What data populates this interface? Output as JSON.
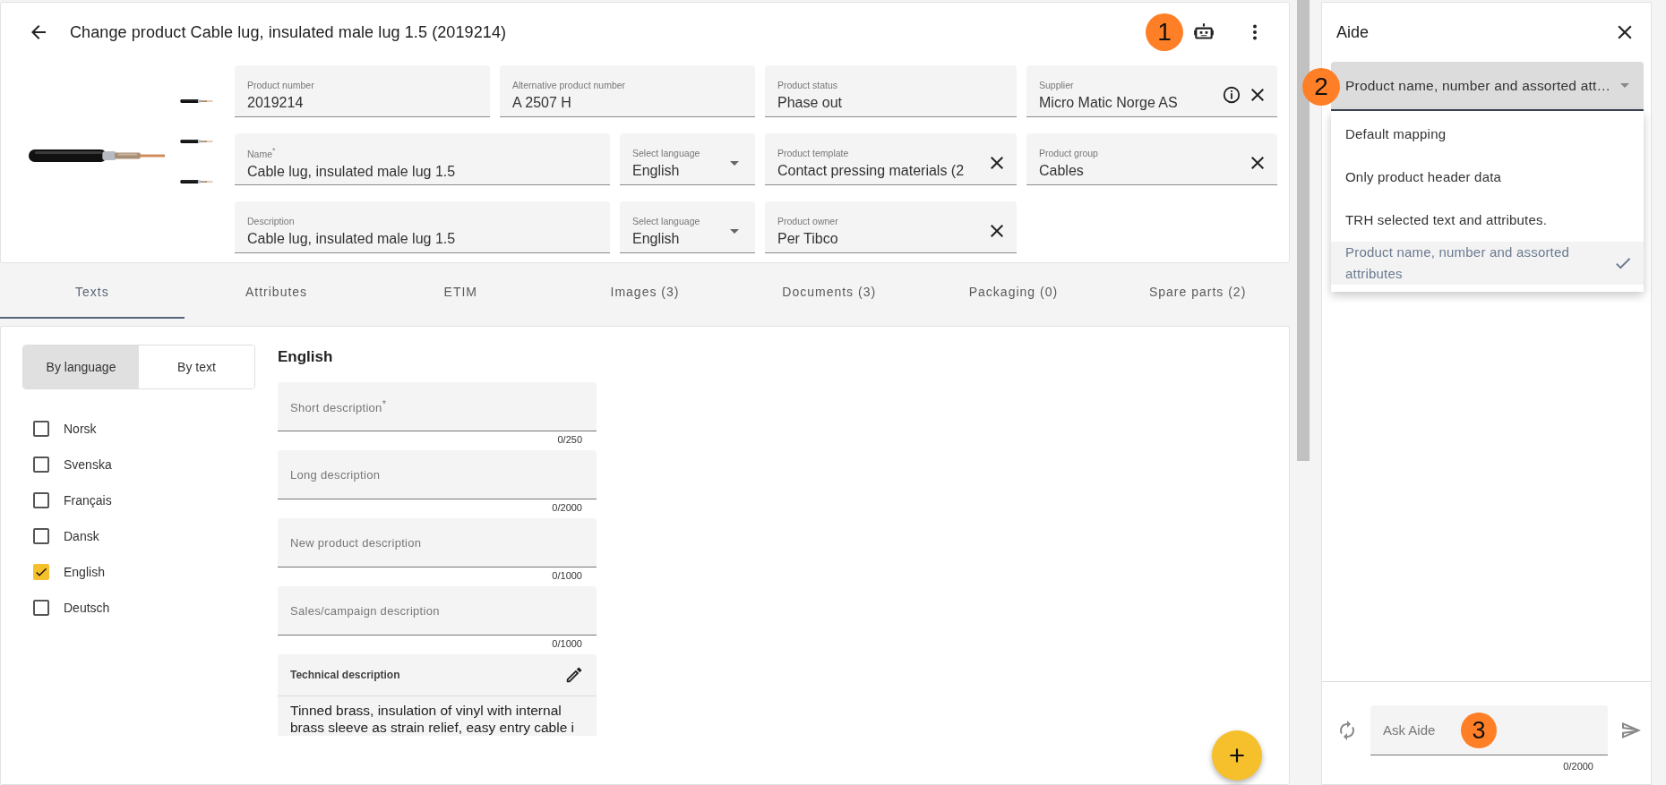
{
  "header": {
    "title": "Change product Cable lug, insulated male lug 1.5 (2019214)",
    "badge": "1"
  },
  "product_fields": [
    [
      {
        "label": "Product number",
        "value": "2019214",
        "kind": "text"
      },
      {
        "label": "Alternative product number",
        "value": "A 2507 H",
        "kind": "text"
      },
      {
        "label": "Product status",
        "value": "Phase out",
        "kind": "text"
      },
      {
        "label": "Supplier",
        "value": "Micro Matic Norge AS",
        "kind": "info_clear"
      }
    ],
    [
      {
        "label": "Name$^{*}$",
        "value": "Cable lug, insulated male lug 1.5",
        "kind": "text"
      },
      {
        "label": "Select language",
        "value": "English",
        "kind": "select"
      },
      {
        "label": "Product template",
        "value": "Contact pressing materials (2",
        "kind": "clear"
      },
      {
        "label": "Product group",
        "value": "Cables",
        "kind": "clear"
      }
    ],
    [
      {
        "label": "Description",
        "value": "Cable lug, insulated male lug 1.5",
        "kind": "text"
      },
      {
        "label": "Select language",
        "value": "English",
        "kind": "select"
      },
      {
        "label": "Product owner",
        "value": "Per Tibco",
        "kind": "clear"
      }
    ]
  ],
  "tabs": [
    {
      "label": "Texts",
      "selected": true
    },
    {
      "label": "Attributes",
      "selected": false
    },
    {
      "label": "ETIM",
      "selected": false
    },
    {
      "label": "Images (3)",
      "selected": false
    },
    {
      "label": "Documents (3)",
      "selected": false
    },
    {
      "label": "Packaging (0)",
      "selected": false
    },
    {
      "label": "Spare parts (2)",
      "selected": false
    }
  ],
  "view_toggle": [
    {
      "label": "By language",
      "selected": true
    },
    {
      "label": "By text",
      "selected": false
    }
  ],
  "languages": [
    {
      "label": "Norsk",
      "checked": false
    },
    {
      "label": "Svenska",
      "checked": false
    },
    {
      "label": "Français",
      "checked": false
    },
    {
      "label": "Dansk",
      "checked": false
    },
    {
      "label": "English",
      "checked": true
    },
    {
      "label": "Deutsch",
      "checked": false
    }
  ],
  "text_section": {
    "heading": "English",
    "fields": [
      {
        "label": "Short description$^{*}$",
        "counter": "0/250"
      },
      {
        "label": "Long description",
        "counter": "0/2000"
      },
      {
        "label": "New product description",
        "counter": "0/1000"
      },
      {
        "label": "Sales/campaign description",
        "counter": "0/1000"
      }
    ],
    "technical": {
      "label": "Technical description",
      "value": "Tinned brass, insulation of vinyl with internal brass sleeve as strain relief, easy entry cable i"
    }
  },
  "aide": {
    "title": "Aide",
    "dropdown": {
      "value": "Product name, number and assorted att…",
      "badge": "2",
      "options": [
        {
          "label": "Default mapping",
          "selected": false
        },
        {
          "label": "Only product header data",
          "selected": false
        },
        {
          "label": "TRH selected text and attributes.",
          "selected": false
        },
        {
          "label": "Product name, number and assorted attributes",
          "selected": true
        }
      ]
    },
    "input": {
      "placeholder": "Ask Aide",
      "counter": "0/2000",
      "badge": "3"
    }
  }
}
